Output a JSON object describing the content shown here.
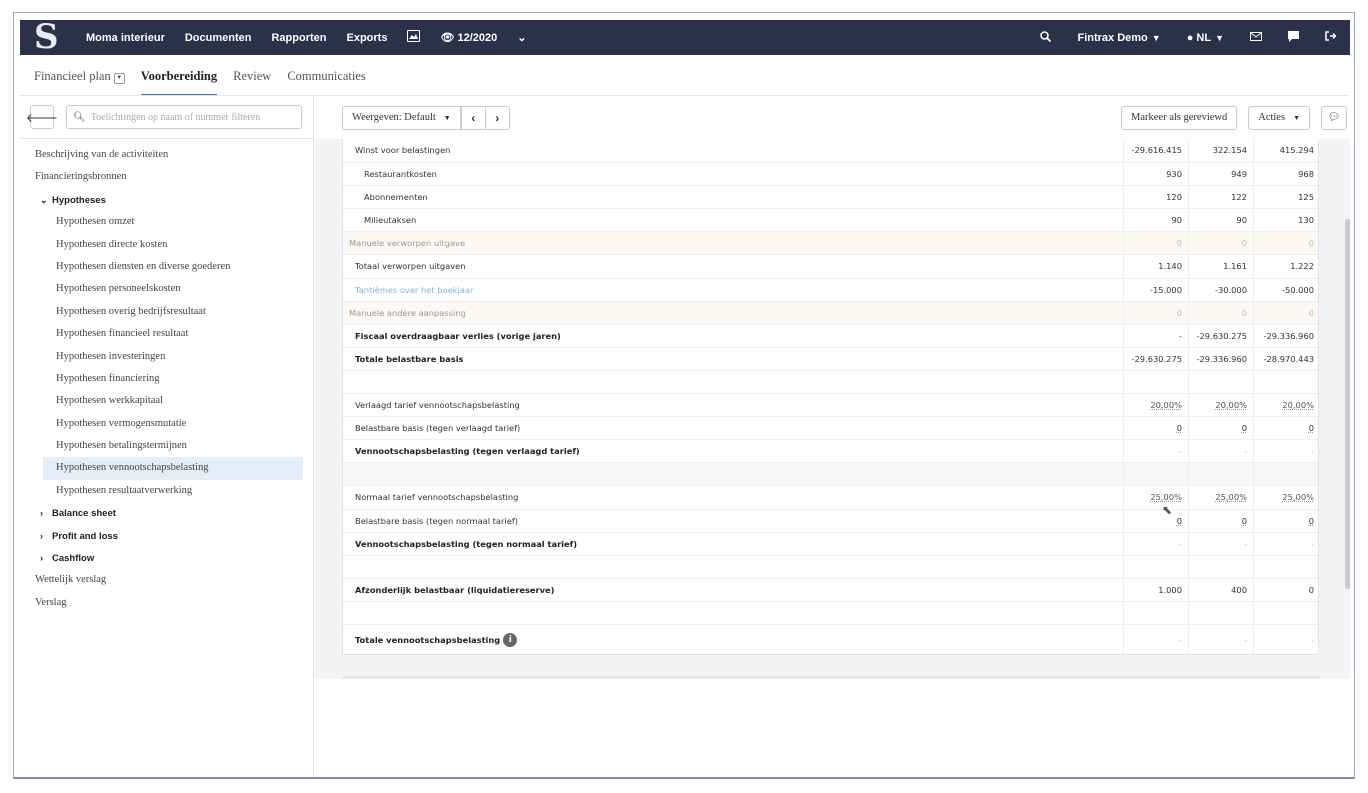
{
  "topnav": {
    "logo": "S",
    "items": [
      "Moma interieur",
      "Documenten",
      "Rapporten",
      "Exports"
    ],
    "period": "12/2020",
    "company": "Fintrax Demo",
    "language": "NL"
  },
  "tabs": [
    {
      "label": "Financieel plan",
      "active": false
    },
    {
      "label": "Voorbereiding",
      "active": true
    },
    {
      "label": "Review",
      "active": false
    },
    {
      "label": "Communicaties",
      "active": false
    }
  ],
  "sidebar": {
    "filter_placeholder": "Toelichtingen op naam of nummer filteren",
    "items": [
      {
        "label": "Beschrijving van de activiteiten",
        "level": 0
      },
      {
        "label": "Financieringsbronnen",
        "level": 0
      },
      {
        "label": "Hypotheses",
        "level": 1,
        "expanded": true
      },
      {
        "label": "Hypothesen omzet",
        "level": 2
      },
      {
        "label": "Hypothesen directe kosten",
        "level": 2
      },
      {
        "label": "Hypothesen diensten en diverse goederen",
        "level": 2
      },
      {
        "label": "Hypothesen personeelskosten",
        "level": 2
      },
      {
        "label": "Hypothesen overig bedrijfsresultaat",
        "level": 2
      },
      {
        "label": "Hypothesen financieel resultaat",
        "level": 2
      },
      {
        "label": "Hypothesen investeringen",
        "level": 2
      },
      {
        "label": "Hypothesen financiering",
        "level": 2
      },
      {
        "label": "Hypothesen werkkapitaal",
        "level": 2
      },
      {
        "label": "Hypothesen vermogensmutatie",
        "level": 2
      },
      {
        "label": "Hypothesen betalingstermijnen",
        "level": 2
      },
      {
        "label": "Hypothesen vennootschapsbelasting",
        "level": 2,
        "selected": true
      },
      {
        "label": "Hypothesen resultaatverwerking",
        "level": 2
      },
      {
        "label": "Balance sheet",
        "level": 1,
        "expanded": false
      },
      {
        "label": "Profit and loss",
        "level": 1,
        "expanded": false
      },
      {
        "label": "Cashflow",
        "level": 1,
        "expanded": false
      },
      {
        "label": "Wettelijk verslag",
        "level": 0
      },
      {
        "label": "Verslag",
        "level": 0
      }
    ]
  },
  "toolbar": {
    "view_label": "Weergeven: Default",
    "mark_reviewed": "Markeer als gereviewd",
    "actions": "Acties"
  },
  "table": {
    "rows": [
      {
        "label": "Winst voor belastingen",
        "values": [
          "-29.616.415",
          "322.154",
          "415.294"
        ],
        "style": ""
      },
      {
        "label": "Restaurantkosten",
        "values": [
          "930",
          "949",
          "968"
        ],
        "style": "indent"
      },
      {
        "label": "Abonnementen",
        "values": [
          "120",
          "122",
          "125"
        ],
        "style": "indent"
      },
      {
        "label": "Milieutaksen",
        "values": [
          "90",
          "90",
          "130"
        ],
        "style": "indent"
      },
      {
        "label": "Manuele verworpen uitgave",
        "values": [
          "0",
          "0",
          "0"
        ],
        "style": "manual"
      },
      {
        "label": "Totaal verworpen uitgaven",
        "values": [
          "1.140",
          "1.161",
          "1.222"
        ],
        "style": ""
      },
      {
        "label": "Tantièmes over het boekjaar",
        "values": [
          "-15.000",
          "-30.000",
          "-50.000"
        ],
        "style": "link"
      },
      {
        "label": "Manuele andere aanpassing",
        "values": [
          "0",
          "0",
          "0"
        ],
        "style": "manual"
      },
      {
        "label": "Fiscaal overdraagbaar verlies (vorige jaren)",
        "values": [
          "-",
          "-29.630.275",
          "-29.336.960"
        ],
        "style": "bold"
      },
      {
        "label": "Totale belastbare basis",
        "values": [
          "-29.630.275",
          "-29.336.960",
          "-28.970.443"
        ],
        "style": "bold"
      },
      {
        "label": "",
        "values": [
          "",
          "",
          ""
        ],
        "style": "empty"
      },
      {
        "label": "Verlaagd tarief vennootschapsbelasting",
        "values": [
          "20,00%",
          "20,00%",
          "20,00%"
        ],
        "style": "pct"
      },
      {
        "label": "Belastbare basis (tegen verlaagd tarief)",
        "values": [
          "0",
          "0",
          "0"
        ],
        "style": "ul"
      },
      {
        "label": "Vennootschapsbelasting (tegen verlaagd tarief)",
        "values": [
          "-",
          "-",
          "-"
        ],
        "style": "bold dash"
      },
      {
        "label": "",
        "values": [
          "",
          "",
          ""
        ],
        "style": "grey"
      },
      {
        "label": "Normaal tarief vennootschapsbelasting",
        "values": [
          "25,00%",
          "25,00%",
          "25,00%"
        ],
        "style": "pct"
      },
      {
        "label": "Belastbare basis (tegen normaal tarief)",
        "values": [
          "0",
          "0",
          "0"
        ],
        "style": "ul"
      },
      {
        "label": "Vennootschapsbelasting (tegen normaal tarief)",
        "values": [
          "-",
          "-",
          "-"
        ],
        "style": "bold dash"
      },
      {
        "label": "",
        "values": [
          "",
          "",
          ""
        ],
        "style": "empty"
      },
      {
        "label": "Afzonderlijk belastbaar (liquidatiereserve)",
        "values": [
          "1.000",
          "400",
          "0"
        ],
        "style": "bold"
      },
      {
        "label": "",
        "values": [
          "",
          "",
          ""
        ],
        "style": "empty"
      },
      {
        "label": "Totale vennootschapsbelasting",
        "values": [
          "-",
          "-",
          "-"
        ],
        "style": "bold dash tall info"
      }
    ]
  }
}
